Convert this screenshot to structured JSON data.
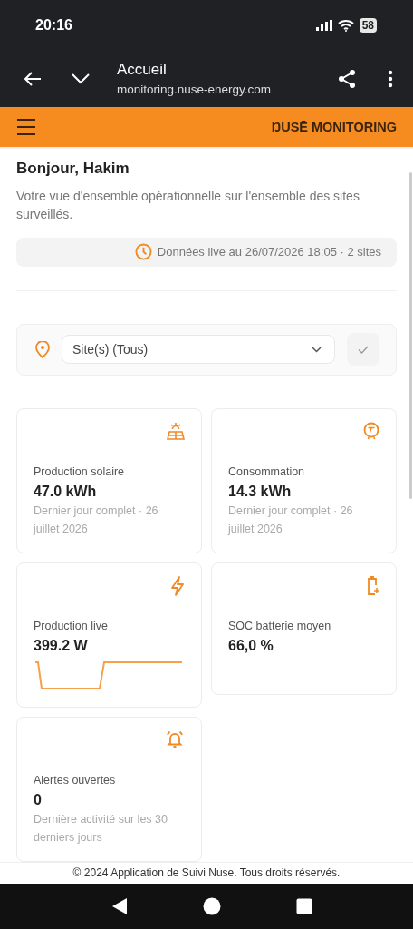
{
  "status_bar": {
    "time": "20:16",
    "battery": "58"
  },
  "browser": {
    "title": "Accueil",
    "url": "monitoring.nuse-energy.com"
  },
  "app_header": {
    "brand": "ŊUSĒ MONITORING"
  },
  "greeting": "Bonjour, Hakim",
  "subtitle": "Votre vue d'ensemble opérationnelle sur l'ensemble des sites surveillés.",
  "live_info": "Données live au 26/07/2026 18:05 · 2 sites",
  "site_filter": {
    "value": "Site(s) (Tous)"
  },
  "cards": [
    {
      "kind": "solar",
      "label": "Production solaire",
      "value": "47.0 kWh",
      "note": "Dernier jour complet · 26 juillet 2026"
    },
    {
      "kind": "consumption",
      "label": "Consommation",
      "value": "14.3 kWh",
      "note": "Dernier jour complet · 26 juillet 2026"
    },
    {
      "kind": "live",
      "label": "Production live",
      "value": "399.2 W"
    },
    {
      "kind": "battery",
      "label": "SOC batterie moyen",
      "value": "66,0 %"
    },
    {
      "kind": "alerts",
      "label": "Alertes ouvertes",
      "value": "0",
      "note": "Dernière activité sur les 30 derniers jours"
    }
  ],
  "footer": "© 2024 Application de Suivi Nuse. Tous droits réservés."
}
